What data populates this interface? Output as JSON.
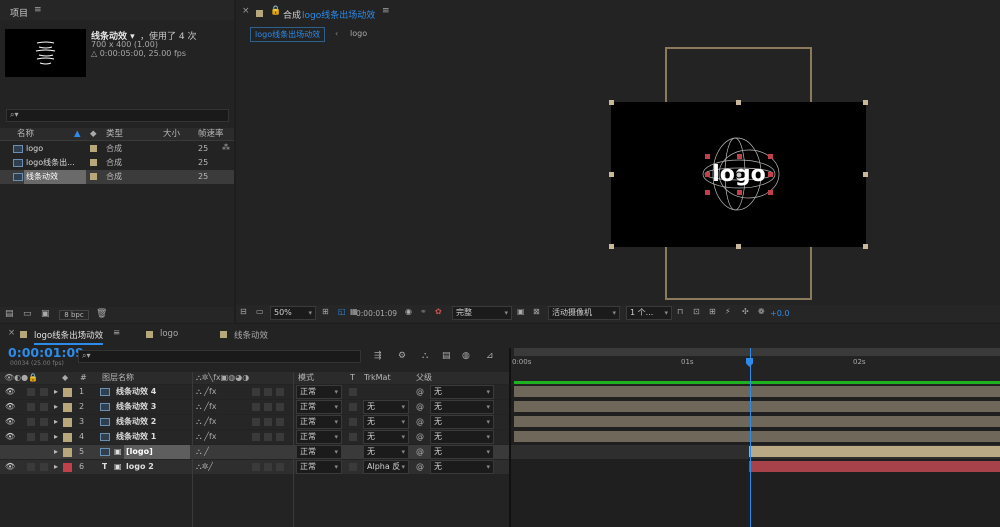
{
  "project": {
    "tab": "项目",
    "menu": "≡",
    "comp_name": "线条动效 ▾",
    "used": "，使用了 4 次",
    "size_info": "700 x 400 (1.00)",
    "duration": "△ 0:00:05:00, 25.00 fps",
    "search_icon": "⌕▾",
    "columns": {
      "name": "名称",
      "type": "类型",
      "size": "大小",
      "fps": "帧速率"
    },
    "items": [
      {
        "name": "logo",
        "type": "合成",
        "fps": "25"
      },
      {
        "name": "logo线条出...",
        "type": "合成",
        "fps": "25"
      },
      {
        "name": "线条动效",
        "type": "合成",
        "fps": "25"
      }
    ],
    "bpc": "8 bpc"
  },
  "viewer": {
    "title": "合成",
    "comp": "logo线条出场动效",
    "menu": "≡",
    "crumb1": "logo线条出场动效",
    "crumb2": "logo",
    "logo_text": "logo",
    "zoom": "50%",
    "timecode": "0:00:01:09",
    "quality": "完整",
    "camera": "活动摄像机",
    "views": "1 个...",
    "exposure": "+0.0"
  },
  "timeline": {
    "tabs": [
      "logo线条出场动效",
      "logo",
      "线条动效"
    ],
    "timecode": "0:00:01:09",
    "frames": "00034 (25.00 fps)",
    "search": "⌕▾",
    "headers": {
      "num": "#",
      "name": "图层名称",
      "mode": "模式",
      "t": "T",
      "trkmat": "TrkMat",
      "parent": "父级"
    },
    "ruler": [
      "0:00s",
      "01s",
      "02s"
    ],
    "layers": [
      {
        "num": "1",
        "name": "线条动效 4",
        "mode": "正常",
        "trk": "",
        "parent": "无",
        "color": "#b9a77c"
      },
      {
        "num": "2",
        "name": "线条动效 3",
        "mode": "正常",
        "trk": "无",
        "parent": "无",
        "color": "#b9a77c"
      },
      {
        "num": "3",
        "name": "线条动效 2",
        "mode": "正常",
        "trk": "无",
        "parent": "无",
        "color": "#b9a77c"
      },
      {
        "num": "4",
        "name": "线条动效 1",
        "mode": "正常",
        "trk": "无",
        "parent": "无",
        "color": "#b9a77c"
      },
      {
        "num": "5",
        "name": "[logo]",
        "mode": "正常",
        "trk": "无",
        "parent": "无",
        "color": "#b9a77c"
      },
      {
        "num": "6",
        "name": "logo 2",
        "mode": "正常",
        "trk": "Alpha 反",
        "parent": "无",
        "color": "#c2404a"
      }
    ]
  },
  "colors": {
    "accent": "#2d8ceb",
    "bar_tan": "#8e8270",
    "bar_red": "#a7414a",
    "work_green": "#1fb11f"
  }
}
